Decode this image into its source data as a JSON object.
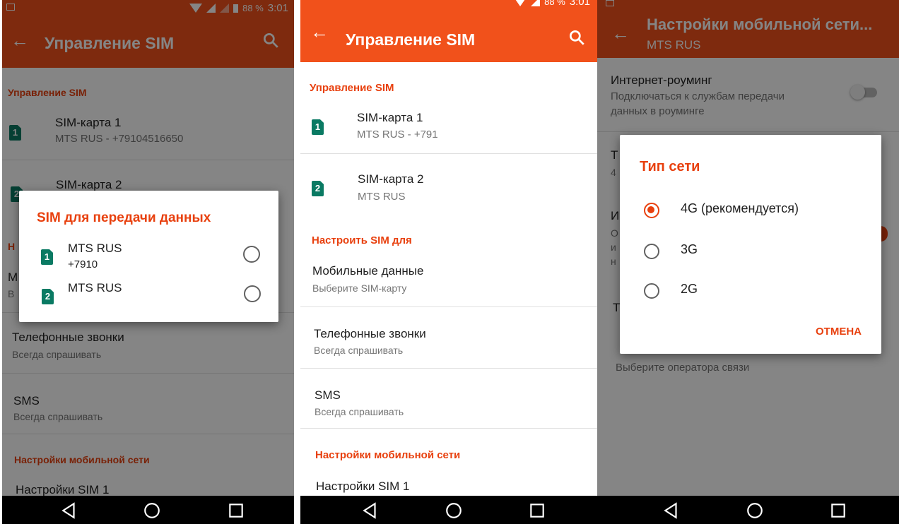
{
  "colors": {
    "accent": "#e8400e",
    "sim_badge": "#0a7a63",
    "appbar": "#f1511b",
    "navbar": "#000000"
  },
  "icons": {
    "back": "arrow-left-icon",
    "search": "magnifier-icon",
    "nav_back": "triangle-back-icon",
    "nav_home": "circle-home-icon",
    "nav_recents": "square-recents-icon"
  },
  "statusbar": {
    "battery": "88 %",
    "time": "3:01"
  },
  "left_screen": {
    "title": "Управление SIM",
    "section_sim": "Управление SIM",
    "sims": [
      {
        "badge": "1",
        "name": "SIM-карта 1",
        "detail": "MTS RUS - +79104516650"
      },
      {
        "badge": "2",
        "name": "SIM-карта 2"
      }
    ],
    "partial_letters": [
      "Н",
      "М",
      "В"
    ],
    "calls": {
      "title": "Телефонные звонки",
      "sub": "Всегда спрашивать"
    },
    "sms": {
      "title": "SMS",
      "sub": "Всегда спрашивать"
    },
    "section_network": "Настройки мобильной сети",
    "sim_settings": "Настройки SIM 1",
    "dialog": {
      "title": "SIM для передачи данных",
      "options": [
        {
          "badge": "1",
          "name": "MTS RUS",
          "number": "+7910"
        },
        {
          "badge": "2",
          "name": "MTS RUS"
        }
      ]
    }
  },
  "middle_screen": {
    "title": "Управление SIM",
    "section_sim": "Управление SIM",
    "sims": [
      {
        "badge": "1",
        "name": "SIM-карта 1",
        "detail": "MTS RUS - +791"
      },
      {
        "badge": "2",
        "name": "SIM-карта 2",
        "detail": "MTS RUS"
      }
    ],
    "section_setup": "Настроить SIM для",
    "mobile_data": {
      "title": "Мобильные данные",
      "sub": "Выберите SIM-карту"
    },
    "calls": {
      "title": "Телефонные звонки",
      "sub": "Всегда спрашивать"
    },
    "sms": {
      "title": "SMS",
      "sub": "Всегда спрашивать"
    },
    "section_network": "Настройки мобильной сети",
    "sim_settings": "Настройки SIM 1"
  },
  "right_screen": {
    "title": "Настройки мобильной сети...",
    "subtitle": "MTS RUS",
    "roaming": {
      "title": "Интернет-роуминг",
      "sub": "Подключаться к службам передачи данных в роуминге",
      "enabled": false
    },
    "partial_letters": [
      "Т",
      "4",
      "И",
      "О",
      "и",
      "н",
      "Т"
    ],
    "operator_sub": "Выберите оператора связи",
    "dialog": {
      "title": "Тип сети",
      "options": [
        {
          "label": "4G (рекомендуется)",
          "selected": true
        },
        {
          "label": "3G",
          "selected": false
        },
        {
          "label": "2G",
          "selected": false
        }
      ],
      "cancel": "ОТМЕНА"
    }
  }
}
